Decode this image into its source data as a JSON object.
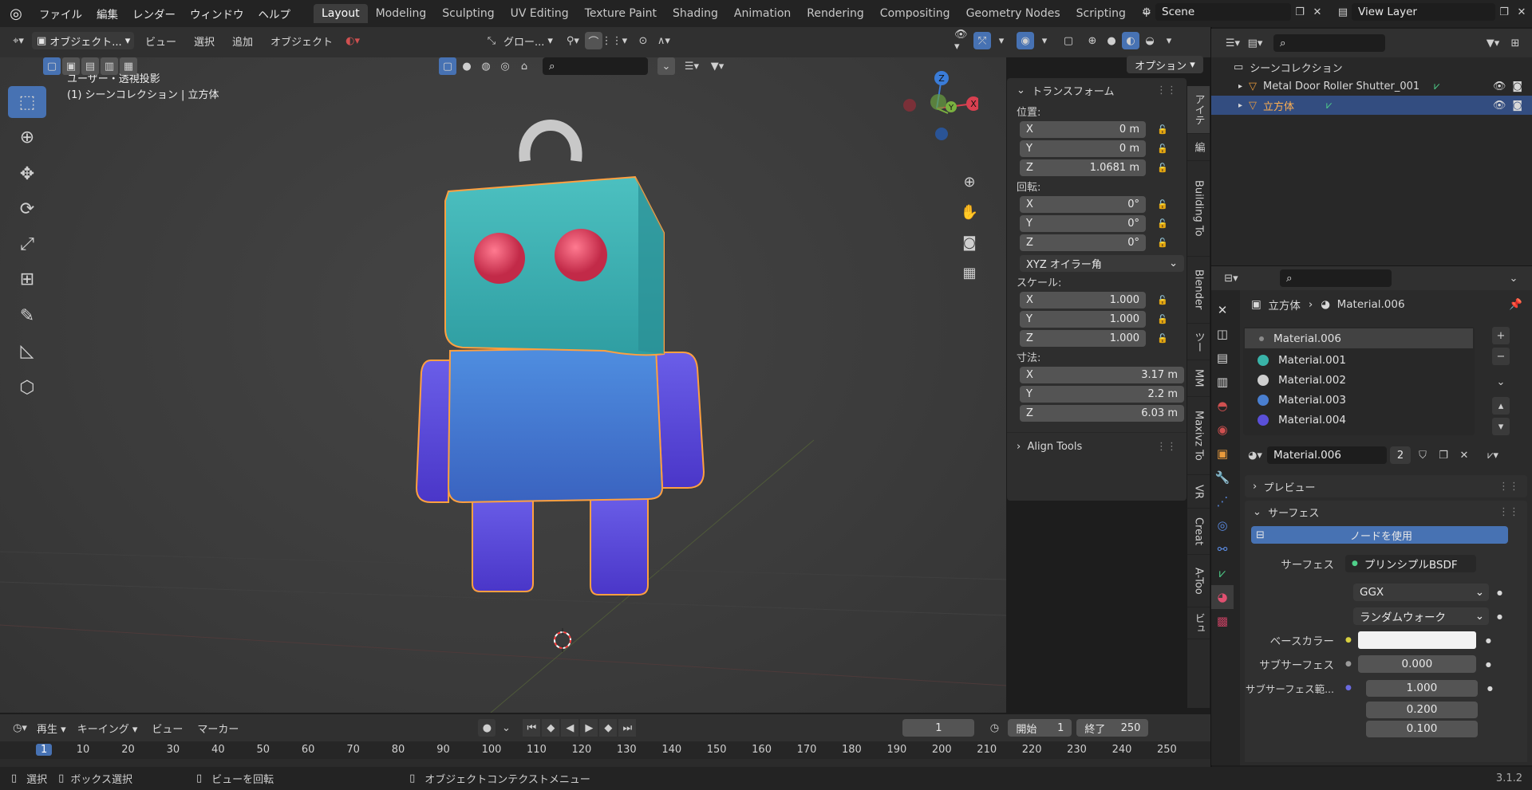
{
  "topbar": {
    "menus": [
      "ファイル",
      "編集",
      "レンダー",
      "ウィンドウ",
      "ヘルプ"
    ],
    "workspaces": [
      "Layout",
      "Modeling",
      "Sculpting",
      "UV Editing",
      "Texture Paint",
      "Shading",
      "Animation",
      "Rendering",
      "Compositing",
      "Geometry Nodes",
      "Scripting"
    ],
    "active_workspace": "Layout",
    "scene": "Scene",
    "view_layer": "View Layer"
  },
  "viewport_header": {
    "mode": "オブジェクト...",
    "menus": [
      "ビュー",
      "選択",
      "追加",
      "オブジェクト"
    ],
    "transform_orient": "グロー...",
    "options": "オプション"
  },
  "viewport": {
    "view_name": "ユーザー・透視投影",
    "collection_info": "(1) シーンコレクション | 立方体",
    "gizmo": {
      "x": "X",
      "y": "Y",
      "z": "Z"
    }
  },
  "npanel": {
    "title": "トランスフォーム",
    "location_label": "位置:",
    "location": [
      {
        "axis": "X",
        "value": "0 m"
      },
      {
        "axis": "Y",
        "value": "0 m"
      },
      {
        "axis": "Z",
        "value": "1.0681 m"
      }
    ],
    "rotation_label": "回転:",
    "rotation": [
      {
        "axis": "X",
        "value": "0°"
      },
      {
        "axis": "Y",
        "value": "0°"
      },
      {
        "axis": "Z",
        "value": "0°"
      }
    ],
    "rotation_mode": "XYZ オイラー角",
    "scale_label": "スケール:",
    "scale": [
      {
        "axis": "X",
        "value": "1.000"
      },
      {
        "axis": "Y",
        "value": "1.000"
      },
      {
        "axis": "Z",
        "value": "1.000"
      }
    ],
    "dimensions_label": "寸法:",
    "dimensions": [
      {
        "axis": "X",
        "value": "3.17 m"
      },
      {
        "axis": "Y",
        "value": "2.2 m"
      },
      {
        "axis": "Z",
        "value": "6.03 m"
      }
    ],
    "align_tools": "Align Tools",
    "tabs": [
      "アイテ",
      "編",
      "Building To",
      "Blender",
      "ツー",
      "MM",
      "Maxivz To",
      "VR",
      "Creat",
      "A-Too",
      "ビュ"
    ]
  },
  "outliner": {
    "root": "シーンコレクション",
    "items": [
      {
        "name": "Metal Door Roller Shutter_001",
        "selected": false
      },
      {
        "name": "立方体",
        "selected": true
      }
    ]
  },
  "properties": {
    "breadcrumb_object": "立方体",
    "breadcrumb_material": "Material.006",
    "materials": [
      {
        "name": "Material.006",
        "color": "#9a9a9a"
      },
      {
        "name": "Material.001",
        "color": "#39b3a8"
      },
      {
        "name": "Material.002",
        "color": "#cfcfcf"
      },
      {
        "name": "Material.003",
        "color": "#4a7fd0"
      },
      {
        "name": "Material.004",
        "color": "#5a50d8"
      }
    ],
    "material_name": "Material.006",
    "users": "2",
    "preview": "プレビュー",
    "surface_panel": "サーフェス",
    "use_nodes": "ノードを使用",
    "surface_label": "サーフェス",
    "surface_value": "プリンシプルBSDF",
    "distribution": "GGX",
    "subsurface_method": "ランダムウォーク",
    "base_color_label": "ベースカラー",
    "subsurface_label": "サブサーフェス",
    "subsurface_value": "0.000",
    "subsurface_radius_label": "サブサーフェス範...",
    "radius": [
      "1.000",
      "0.200",
      "0.100"
    ]
  },
  "timeline": {
    "menus": [
      "再生",
      "キーイング",
      "ビュー",
      "マーカー"
    ],
    "current_frame": "1",
    "start_label": "開始",
    "start": "1",
    "end_label": "終了",
    "end": "250",
    "ticks": [
      "1",
      "10",
      "20",
      "30",
      "40",
      "50",
      "60",
      "70",
      "80",
      "90",
      "100",
      "110",
      "120",
      "130",
      "140",
      "150",
      "160",
      "170",
      "180",
      "190",
      "200",
      "210",
      "220",
      "230",
      "240",
      "250"
    ]
  },
  "statusbar": {
    "select": "選択",
    "box_select": "ボックス選択",
    "rotate_view": "ビューを回転",
    "context_menu": "オブジェクトコンテクストメニュー",
    "version": "3.1.2"
  },
  "colors": {
    "accent": "#4772b3",
    "selection": "#ffa040",
    "head": "#38aab0",
    "body": "#4a78d0",
    "limbs": "#5a48d8",
    "eyes": "#d83a58"
  }
}
